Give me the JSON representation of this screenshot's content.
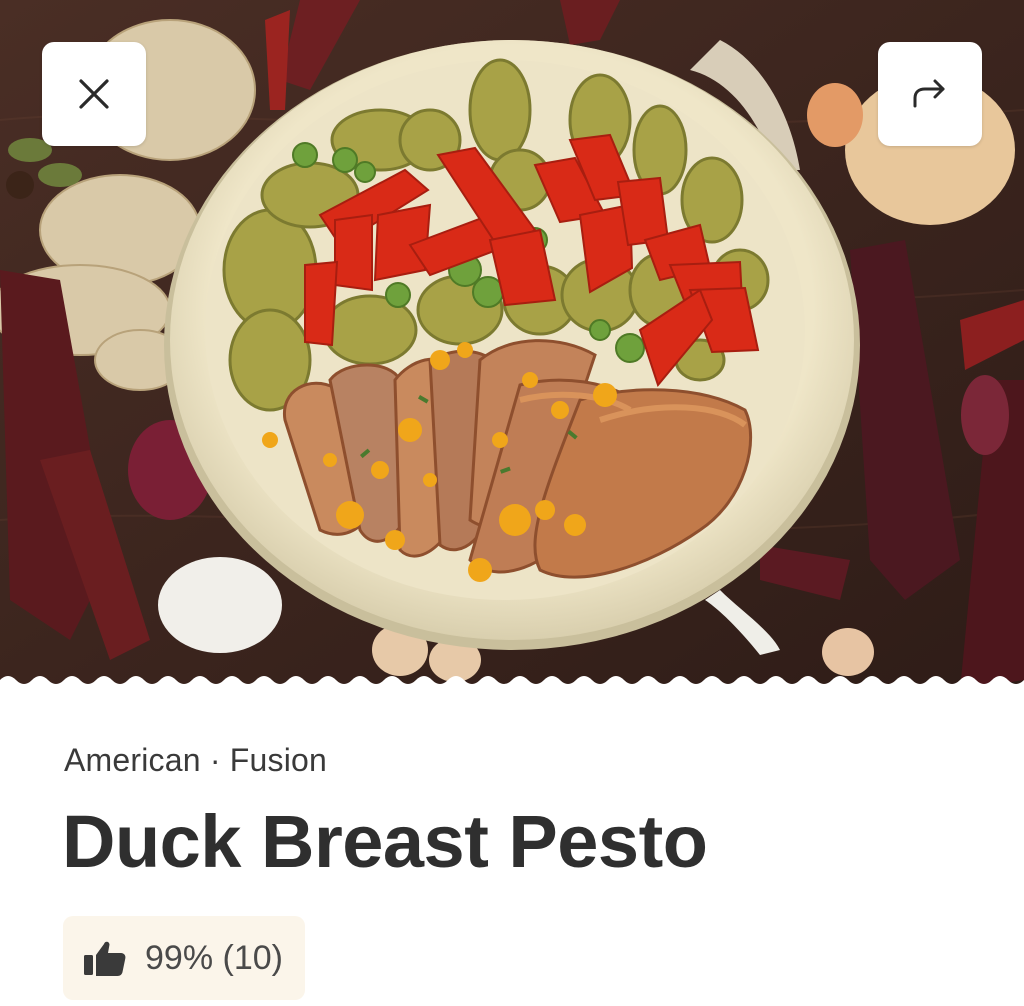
{
  "hero": {
    "close_button": {
      "icon": "close-icon"
    },
    "share_button": {
      "icon": "share-arrow-icon"
    }
  },
  "recipe": {
    "cuisine": "American · Fusion",
    "title": "Duck Breast Pesto",
    "rating": {
      "icon": "thumbs-up-icon",
      "text": "99% (10)",
      "percent": 99,
      "count": 10
    }
  },
  "colors": {
    "rating_bg": "#fbf5ea",
    "title_text": "#2f2f2f",
    "wood": "#3a2620"
  }
}
